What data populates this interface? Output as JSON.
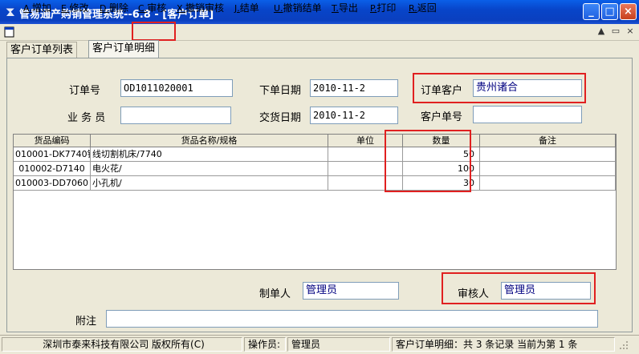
{
  "window": {
    "title": "管易通产购销管理系统--6.8 - [客户订单]",
    "min_label": "_",
    "max_label": "□",
    "close_label": "×"
  },
  "menu": [
    {
      "key": "A.",
      "label": "增加"
    },
    {
      "key": "E.",
      "label": "修改"
    },
    {
      "key": "D.",
      "label": "删除"
    },
    {
      "key": "C.",
      "label": "审核"
    },
    {
      "key": "X.",
      "label": "撤销审核"
    },
    {
      "key": "J.",
      "label": "结单"
    },
    {
      "key": "U.",
      "label": "撤销结单"
    },
    {
      "key": "T.",
      "label": "导出"
    },
    {
      "key": "P.",
      "label": "打印"
    },
    {
      "key": "R.",
      "label": "返回"
    }
  ],
  "mdi": {
    "up": "▲",
    "restore": "▭",
    "close": "×"
  },
  "tabs": [
    "客户订单列表",
    "客户订单明细"
  ],
  "form": {
    "order_no_label": "订单号",
    "order_no": "OD1011020001",
    "order_date_label": "下单日期",
    "order_date": "2010-11-2",
    "customer_label": "订单客户",
    "customer": "贵州诸合",
    "salesman_label": "业 务 员",
    "salesman": "",
    "delivery_date_label": "交货日期",
    "delivery_date": "2010-11-2",
    "customer_no_label": "客户单号",
    "customer_no": "",
    "maker_label": "制单人",
    "maker": "管理员",
    "reviewer_label": "审核人",
    "reviewer": "管理员",
    "note_label": "附注",
    "note": ""
  },
  "grid": {
    "columns": [
      "货品编码",
      "货品名称/规格",
      "单位",
      "数量",
      "备注"
    ],
    "rows": [
      {
        "code": "010001-DK7740锥",
        "name": "线切割机床/7740",
        "unit": "",
        "qty": "50",
        "note": ""
      },
      {
        "code": "010002-D7140",
        "name": "电火花/",
        "unit": "",
        "qty": "100",
        "note": ""
      },
      {
        "code": "010003-DD7060",
        "name": "小孔机/",
        "unit": "",
        "qty": "30",
        "note": ""
      }
    ]
  },
  "status": {
    "company": "深圳市泰来科技有限公司 版权所有(C)",
    "operator_label": "操作员:",
    "operator": "管理员",
    "record_info": "客户订单明细：共 3 条记录 当前为第 1 条"
  }
}
